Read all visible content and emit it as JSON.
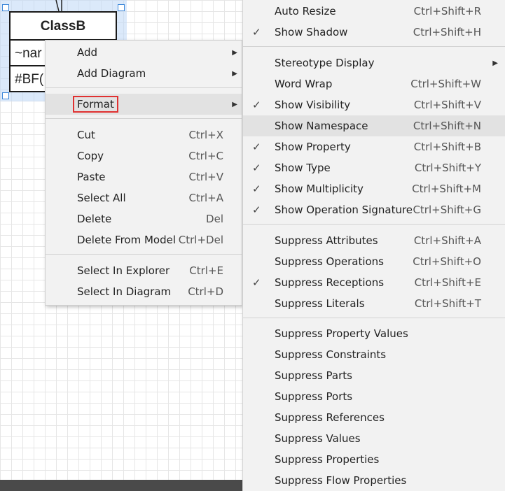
{
  "diagram": {
    "class_name": "ClassB",
    "attributes": [
      "~nar",
      "#BF("
    ]
  },
  "context_menu": {
    "items": [
      {
        "label": "Add",
        "shortcut": "",
        "submenu": true
      },
      {
        "label": "Add Diagram",
        "shortcut": "",
        "submenu": true
      },
      {
        "label": "Format",
        "shortcut": "",
        "submenu": true,
        "active": true
      },
      {
        "label": "Cut",
        "shortcut": "Ctrl+X"
      },
      {
        "label": "Copy",
        "shortcut": "Ctrl+C"
      },
      {
        "label": "Paste",
        "shortcut": "Ctrl+V"
      },
      {
        "label": "Select All",
        "shortcut": "Ctrl+A"
      },
      {
        "label": "Delete",
        "shortcut": "Del"
      },
      {
        "label": "Delete From Model",
        "shortcut": "Ctrl+Del"
      },
      {
        "label": "Select In Explorer",
        "shortcut": "Ctrl+E"
      },
      {
        "label": "Select In Diagram",
        "shortcut": "Ctrl+D"
      }
    ]
  },
  "format_menu": {
    "items": [
      {
        "label": "Auto Resize",
        "shortcut": "Ctrl+Shift+R",
        "checked": false
      },
      {
        "label": "Show Shadow",
        "shortcut": "Ctrl+Shift+H",
        "checked": true
      },
      {
        "label": "Stereotype Display",
        "shortcut": "",
        "submenu": true,
        "checked": false
      },
      {
        "label": "Word Wrap",
        "shortcut": "Ctrl+Shift+W",
        "checked": false
      },
      {
        "label": "Show Visibility",
        "shortcut": "Ctrl+Shift+V",
        "checked": true
      },
      {
        "label": "Show Namespace",
        "shortcut": "Ctrl+Shift+N",
        "checked": false,
        "active": true
      },
      {
        "label": "Show Property",
        "shortcut": "Ctrl+Shift+B",
        "checked": true
      },
      {
        "label": "Show Type",
        "shortcut": "Ctrl+Shift+Y",
        "checked": true
      },
      {
        "label": "Show Multiplicity",
        "shortcut": "Ctrl+Shift+M",
        "checked": true
      },
      {
        "label": "Show Operation Signature",
        "shortcut": "Ctrl+Shift+G",
        "checked": true
      },
      {
        "label": "Suppress Attributes",
        "shortcut": "Ctrl+Shift+A",
        "checked": false
      },
      {
        "label": "Suppress Operations",
        "shortcut": "Ctrl+Shift+O",
        "checked": false
      },
      {
        "label": "Suppress Receptions",
        "shortcut": "Ctrl+Shift+E",
        "checked": true
      },
      {
        "label": "Suppress Literals",
        "shortcut": "Ctrl+Shift+T",
        "checked": false
      },
      {
        "label": "Suppress Property Values",
        "shortcut": "",
        "checked": false
      },
      {
        "label": "Suppress Constraints",
        "shortcut": "",
        "checked": false
      },
      {
        "label": "Suppress Parts",
        "shortcut": "",
        "checked": false
      },
      {
        "label": "Suppress Ports",
        "shortcut": "",
        "checked": false
      },
      {
        "label": "Suppress References",
        "shortcut": "",
        "checked": false
      },
      {
        "label": "Suppress Values",
        "shortcut": "",
        "checked": false
      },
      {
        "label": "Suppress Properties",
        "shortcut": "",
        "checked": false
      },
      {
        "label": "Suppress Flow Properties",
        "shortcut": "",
        "checked": false
      }
    ]
  },
  "glyphs": {
    "check": "✓",
    "submenu_arrow": "▶"
  },
  "colors": {
    "highlight_border": "#e03131",
    "active_item": "#e2e2e2",
    "selection_handle": "#3b86d9"
  }
}
